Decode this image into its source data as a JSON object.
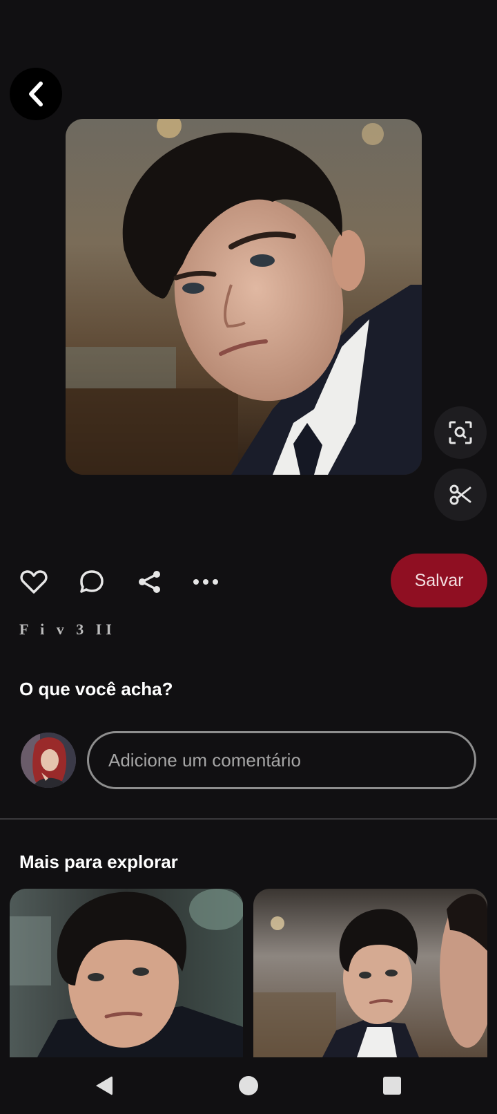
{
  "app": {
    "accent_color": "#8f0f22",
    "background_color": "#111012"
  },
  "header": {
    "back_icon": "chevron-left-icon"
  },
  "pin": {
    "image_description_icon": "photo",
    "side_tools": [
      "visual-search-icon",
      "scissors-icon"
    ]
  },
  "actions": {
    "icons": [
      "heart-icon",
      "comment-icon",
      "share-icon",
      "more-icon"
    ],
    "save_label": "Salvar"
  },
  "pin_title": "F i v 3  II",
  "comments": {
    "prompt": "O que você acha?",
    "placeholder": "Adicione um comentário"
  },
  "explore": {
    "title": "Mais para explorar"
  },
  "navbar": {
    "icons": [
      "nav-back-icon",
      "nav-home-icon",
      "nav-recents-icon"
    ]
  }
}
